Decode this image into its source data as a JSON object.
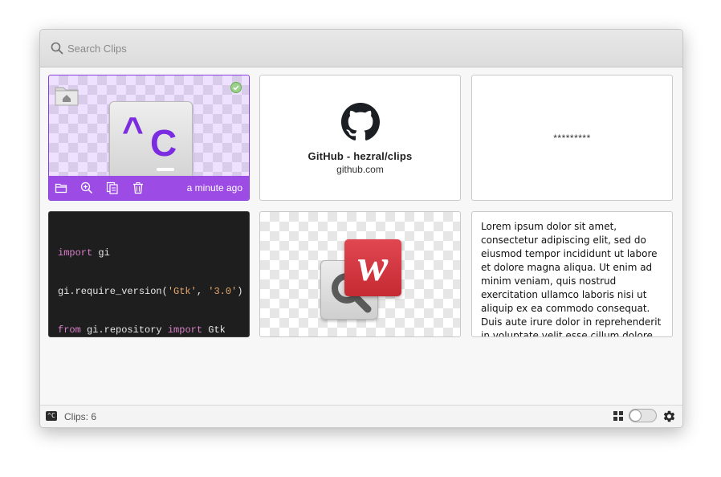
{
  "search": {
    "placeholder": "Search Clips"
  },
  "clips": {
    "app_clip": {
      "time_label": "a minute ago",
      "letter": "C",
      "caret": "^"
    },
    "github": {
      "title": "GitHub - hezral/clips",
      "domain": "github.com"
    },
    "password": {
      "masked": "*********"
    },
    "code": {
      "line1_kw": "import",
      "line1_rest": " gi",
      "line2_a": "gi.require_version(",
      "line2_str1": "'Gtk'",
      "line2_b": ", ",
      "line2_str2": "'3.0'",
      "line2_c": ")",
      "line3_kw1": "from",
      "line3_mid": " gi.repository ",
      "line3_kw2": "import",
      "line3_end": " Gtk"
    },
    "image": {
      "badge_letter": "w"
    },
    "text": {
      "content": "Lorem ipsum dolor sit amet, consectetur adipiscing elit, sed do eiusmod tempor incididunt ut labore et dolore magna aliqua. Ut enim ad minim veniam, quis nostrud exercitation ullamco laboris nisi ut aliquip ex ea commodo consequat. Duis aute irure dolor in reprehenderit in voluptate velit esse cillum dolore eu fugiat nulla pariatur. Excepteur sint occaecat cupidatat non proident."
    }
  },
  "status": {
    "clip_count": "Clips: 6",
    "app_icon_label": "^C"
  },
  "colors": {
    "accent": "#9c4ce4",
    "check": "#7ac462"
  },
  "icons": {
    "search": "search-icon",
    "folder": "folder-icon",
    "zoom": "zoom-in-icon",
    "copy": "copy-icon",
    "trash": "trash-icon",
    "check": "checkmark-icon",
    "github": "github-logo-icon",
    "grid": "grid-view-icon",
    "settings": "gear-icon"
  }
}
